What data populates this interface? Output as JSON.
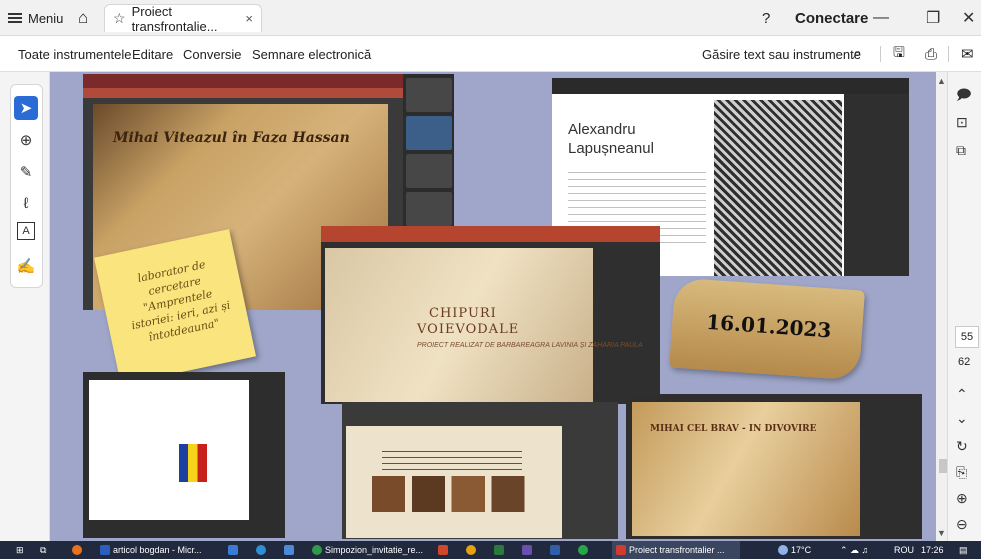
{
  "titlebar": {
    "menu_label": "Meniu",
    "tab_title": "Proiect transfrontalie...",
    "tab_close": "×",
    "connect_label": "Conectare",
    "help_icon": "?",
    "home_icon": "⌂",
    "star_icon": "☆",
    "minimize": "—",
    "maximize": "❐",
    "close": "✕"
  },
  "menubar": {
    "items": [
      "Toate instrumentele",
      "Editare",
      "Conversie",
      "Semnare electronică"
    ],
    "search_text": "Găsire text sau instrumente",
    "search_icon": "⌕",
    "save_icon": "🖫",
    "print_icon": "⎙",
    "mail_icon": "✉"
  },
  "tools": [
    {
      "name": "select-tool",
      "glyph": "➤",
      "active": true
    },
    {
      "name": "comment-tool",
      "glyph": "⊕"
    },
    {
      "name": "pen-tool",
      "glyph": "✎"
    },
    {
      "name": "lasso-tool",
      "glyph": "ℓ"
    },
    {
      "name": "text-select-tool",
      "glyph": "A"
    },
    {
      "name": "sign-tool",
      "glyph": "✍"
    }
  ],
  "slides": {
    "s1_title": "Mihai Viteazul în Faza Hassan",
    "s2_name_line1": "Alexandru",
    "s2_name_line2": "Lapușneanul",
    "s3_title_line1": "CHIPURI",
    "s3_title_line2": "VOIEVODALE",
    "s3_subtitle": "PROIECT REALIZAT DE BARBAREAGRA LAVINIA ȘI ZAHARIA PAULA",
    "s6_title": "MIHAI CEL BRAV - IN DIVOVIRE"
  },
  "sticky": {
    "text": "laborator de cercetare \"Amprentele istoriei: ieri, azi și întotdeauna\""
  },
  "scroll": {
    "date": "16.01.2023"
  },
  "rightrail": {
    "page_current": "55",
    "page_total": "62",
    "up": "⌃",
    "down": "⌄",
    "refresh": "↻",
    "zoom_in": "⊕",
    "zoom_out": "⊖"
  },
  "taskbar": {
    "apps": [
      {
        "label": "articol bogdan - Micr...",
        "color": "#2b5fbf"
      },
      {
        "label": "Simpozion_invitatie_re...",
        "color": "#2f9a4a"
      },
      {
        "label": "Proiect transfrontalier ...",
        "color": "#d23b2f"
      }
    ],
    "weather": "17°C",
    "lang": "ROU",
    "time": "17:26"
  }
}
